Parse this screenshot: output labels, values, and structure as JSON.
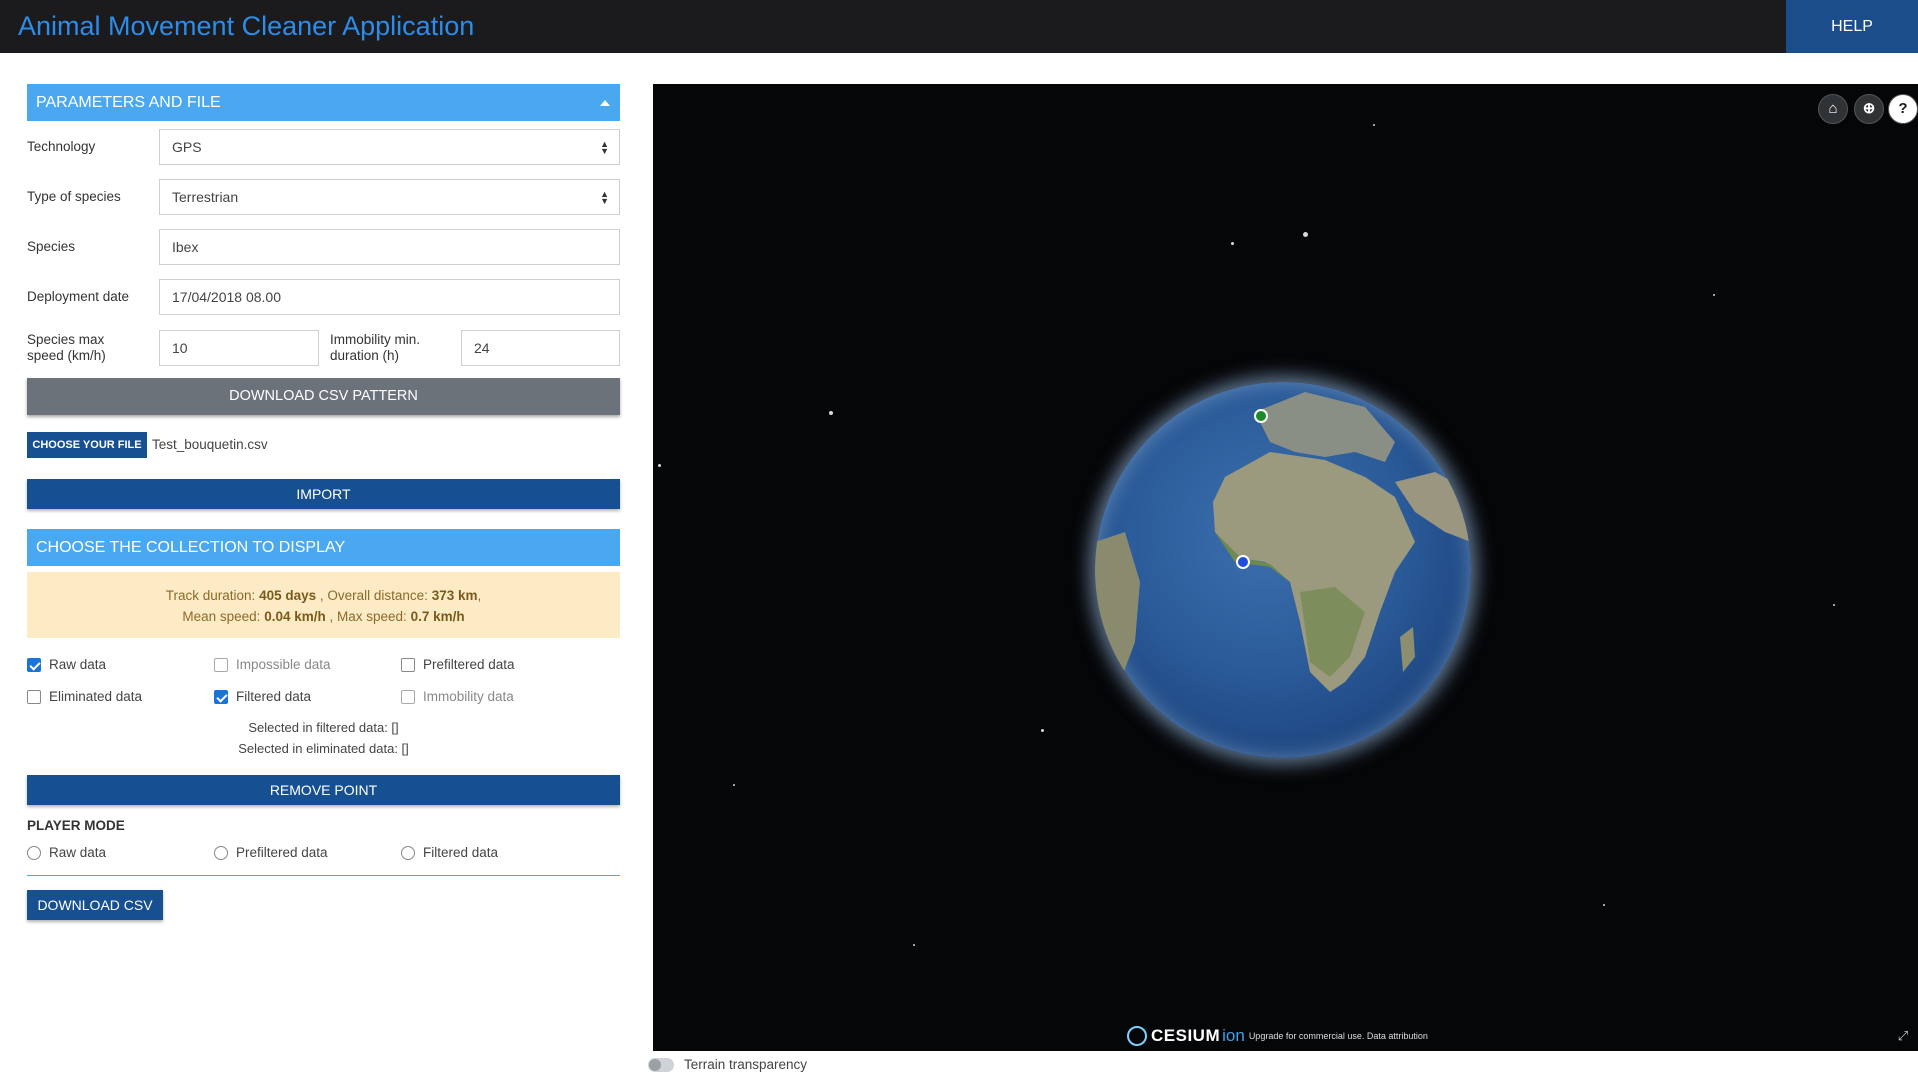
{
  "app": {
    "title": "Animal Movement Cleaner Application",
    "help_label": "HELP"
  },
  "params": {
    "header": "PARAMETERS AND FILE",
    "technology_label": "Technology",
    "technology_value": "GPS",
    "species_type_label": "Type of species",
    "species_type_value": "Terrestrian",
    "species_label": "Species",
    "species_value": "Ibex",
    "deployment_label": "Deployment date",
    "deployment_value": "17/04/2018 08.00",
    "max_speed_label_1": "Species max",
    "max_speed_label_2": "speed (km/h)",
    "max_speed_value": "10",
    "immobility_label_1": "Immobility min.",
    "immobility_label_2": "duration (h)",
    "immobility_value": "24",
    "download_pattern_label": "DOWNLOAD CSV PATTERN",
    "choose_file_label": "CHOOSE YOUR FILE",
    "file_name": "Test_bouquetin.csv",
    "import_label": "IMPORT"
  },
  "collection": {
    "header": "CHOOSE THE COLLECTION TO DISPLAY",
    "stats": {
      "track_duration_label": "Track duration:",
      "track_duration_value": "405 days",
      "overall_distance_label": ", Overall distance:",
      "overall_distance_value": "373 km",
      "mean_speed_label": "Mean speed:",
      "mean_speed_value": "0.04 km/h",
      "max_speed_label": ", Max speed:",
      "max_speed_value": "0.7 km/h"
    },
    "checkboxes": {
      "raw": "Raw data",
      "impossible": "Impossible data",
      "prefiltered": "Prefiltered data",
      "eliminated": "Eliminated data",
      "filtered": "Filtered data",
      "immobility": "Immobility data"
    },
    "selected_filtered": "Selected in filtered data: []",
    "selected_eliminated": "Selected in eliminated data: []",
    "remove_point_label": "REMOVE POINT"
  },
  "player": {
    "title": "PLAYER MODE",
    "raw": "Raw data",
    "prefiltered": "Prefiltered data",
    "filtered": "Filtered data",
    "download_label": "DOWNLOAD CSV"
  },
  "viewer": {
    "cesium_logo": "CESIUM",
    "cesium_ion": "ion",
    "credit_text": "Upgrade for commercial use.  Data attribution",
    "home_icon": "home-icon",
    "globe_icon": "globe-icon",
    "help_icon_text": "?",
    "terrain_label": "Terrain transparency"
  },
  "colors": {
    "accent": "#4aa8f0",
    "primary": "#175091",
    "title": "#2d8ce8",
    "marker_green": "#1a8a2a",
    "marker_blue": "#1f4fd8"
  }
}
